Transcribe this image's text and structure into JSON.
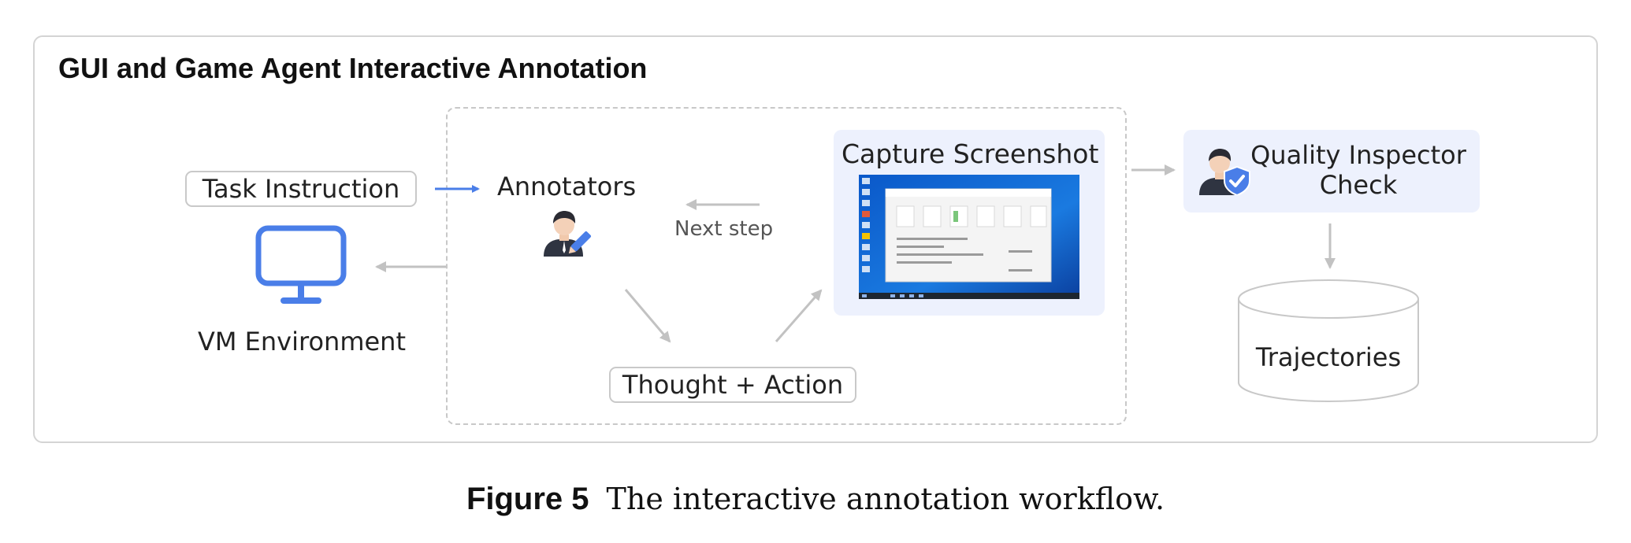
{
  "panel": {
    "title": "GUI and Game Agent Interactive Annotation"
  },
  "nodes": {
    "task_instruction": "Task  Instruction",
    "vm_environment": "VM  Environment",
    "annotators": "Annotators",
    "next_step": "Next step",
    "thought_action": "Thought + Action",
    "capture_screenshot": "Capture Screenshot",
    "quality_inspector": "Quality Inspector Check",
    "trajectories": "Trajectories"
  },
  "icons": {
    "monitor": "monitor-icon",
    "annotator": "annotator-person-pen-icon",
    "inspector": "inspector-person-shield-icon",
    "database": "cylinder-database-icon"
  },
  "colors": {
    "accent_blue": "#4a7ee8",
    "card_bg": "#edf1fd",
    "arrow_gray": "#c2c2c2",
    "border_gray": "#d4d4d4"
  },
  "caption": {
    "label": "Figure 5",
    "text": "The interactive annotation workflow."
  }
}
